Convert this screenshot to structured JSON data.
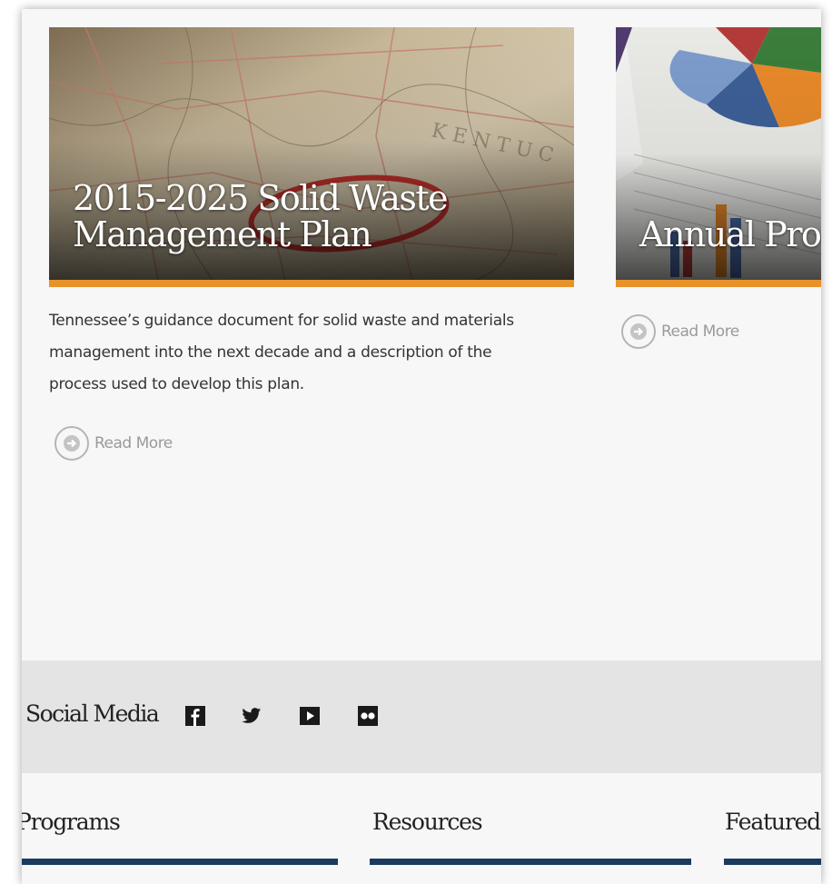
{
  "cards": [
    {
      "title_line1": "2015-2025 Solid Waste",
      "title_line2": "Management Plan",
      "description": "Tennessee’s guidance document for solid waste and materials management into the next decade and a description of the process used to develop this plan.",
      "read_more": "Read More"
    },
    {
      "title": "Annual Prog",
      "read_more": "Read More"
    }
  ],
  "social": {
    "label": "Social Media",
    "icons": [
      "facebook-icon",
      "twitter-icon",
      "youtube-icon",
      "flickr-icon"
    ]
  },
  "footer": {
    "columns": [
      "Programs",
      "Resources",
      "Featured"
    ]
  },
  "colors": {
    "accent_orange": "#e8922a",
    "footer_bar_navy": "#1c3a5e",
    "social_band": "#e4e4e4"
  }
}
